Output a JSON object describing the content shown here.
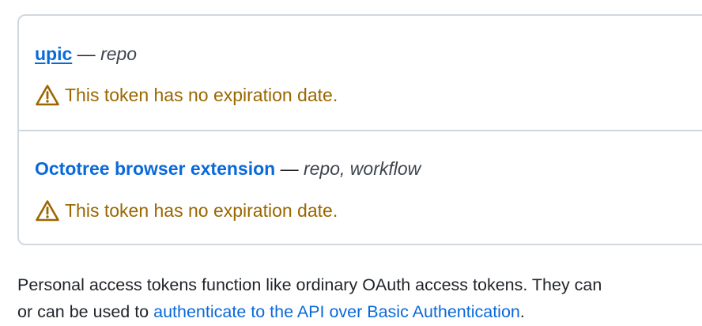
{
  "tokens": [
    {
      "name": "upic",
      "separator": " — ",
      "scopes": "repo",
      "warning": "This token has no expiration date."
    },
    {
      "name": "Octotree browser extension",
      "separator": " — ",
      "scopes": "repo, workflow",
      "warning": "This token has no expiration date."
    }
  ],
  "description": {
    "line1": "Personal access tokens function like ordinary OAuth access tokens. They can",
    "line2_prefix": "or can be used to ",
    "line2_link": "authenticate to the API over Basic Authentication",
    "line2_suffix": "."
  },
  "icons": {
    "warning": "alert-triangle-icon"
  },
  "colors": {
    "link": "#0969da",
    "warning": "#9a6700",
    "border": "#d0d7de",
    "text": "#1f2328"
  }
}
